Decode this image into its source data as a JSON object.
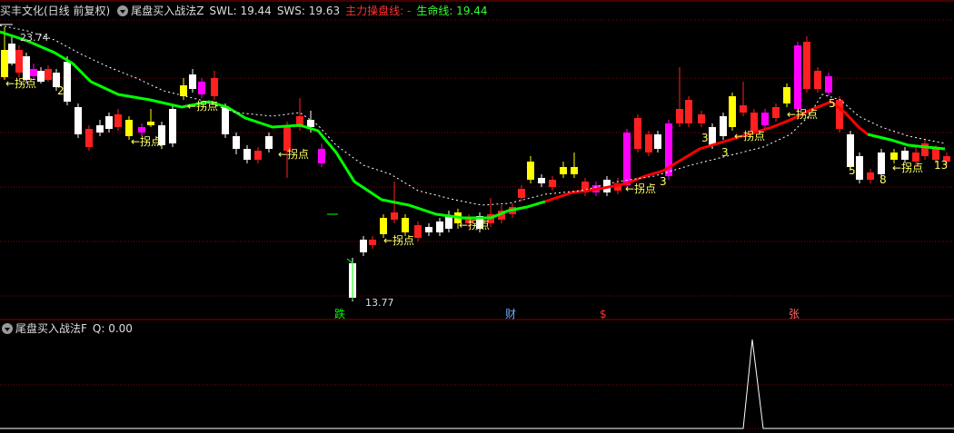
{
  "header_main": {
    "stock": "买丰文化(日线 前复权)",
    "indicator": "尾盘买入战法Z",
    "swl": "SWL: 19.44",
    "sws": "SWS: 19.63",
    "main_line": "主力操盘线: -",
    "life_line": "生命线: 19.44"
  },
  "header_sub": {
    "indicator": "尾盘买入战法F",
    "q": "Q: 0.00"
  },
  "colors": {
    "up": "#ff2020",
    "down": "#ffffff",
    "yellow": "#ffff00",
    "magenta": "#ff00ff",
    "green_line": "#00ff00",
    "red_line": "#ff0000",
    "grid": "#8b0000"
  },
  "chart_data": {
    "type": "candlestick",
    "price_high_label": "23.74",
    "price_low_label": "13.77",
    "y_range": [
      13.3,
      24.5
    ],
    "annotations_turn": "←拐点",
    "markers": [
      {
        "label": "跌",
        "color": "#00ff00"
      },
      {
        "label": "财",
        "color": "#66aaff"
      },
      {
        "label": "$",
        "color": "#ff3333"
      },
      {
        "label": "张",
        "color": "#ff6666"
      }
    ],
    "count_labels": [
      "2",
      "3",
      "3",
      "5",
      "3",
      "5",
      "8",
      "13"
    ],
    "sub_chart": {
      "type": "line",
      "peak_value": 1,
      "baseline": 0
    }
  }
}
